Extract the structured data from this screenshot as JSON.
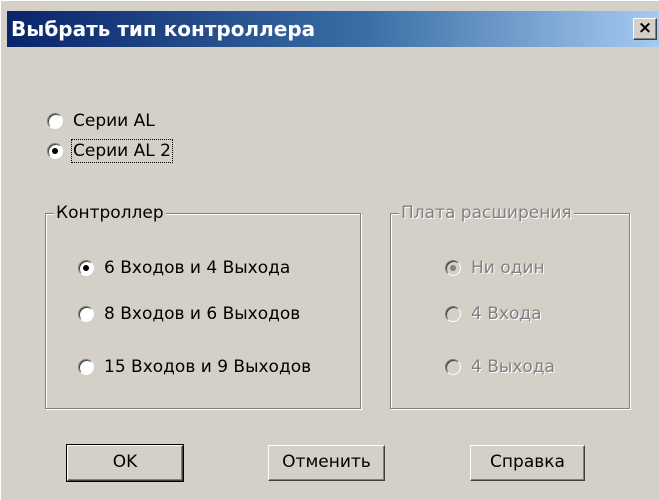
{
  "window": {
    "title": "Выбрать тип контроллера",
    "close_glyph": "×"
  },
  "series": {
    "options": [
      {
        "label": "Серии AL",
        "checked": false
      },
      {
        "label": "Серии AL 2",
        "checked": true
      }
    ]
  },
  "controller_group": {
    "label": "Контроллер",
    "options": [
      {
        "label": "6 Входов и 4 Выхода",
        "checked": true
      },
      {
        "label": "8 Входов и 6 Выходов",
        "checked": false
      },
      {
        "label": "15 Входов и 9 Выходов",
        "checked": false
      }
    ]
  },
  "expansion_group": {
    "label": "Плата расширения",
    "enabled": false,
    "options": [
      {
        "label": "Ни один",
        "checked": true
      },
      {
        "label": "4 Входа",
        "checked": false
      },
      {
        "label": "4 Выхода",
        "checked": false
      }
    ]
  },
  "buttons": {
    "ok": "OK",
    "cancel": "Отменить",
    "help": "Справка"
  }
}
